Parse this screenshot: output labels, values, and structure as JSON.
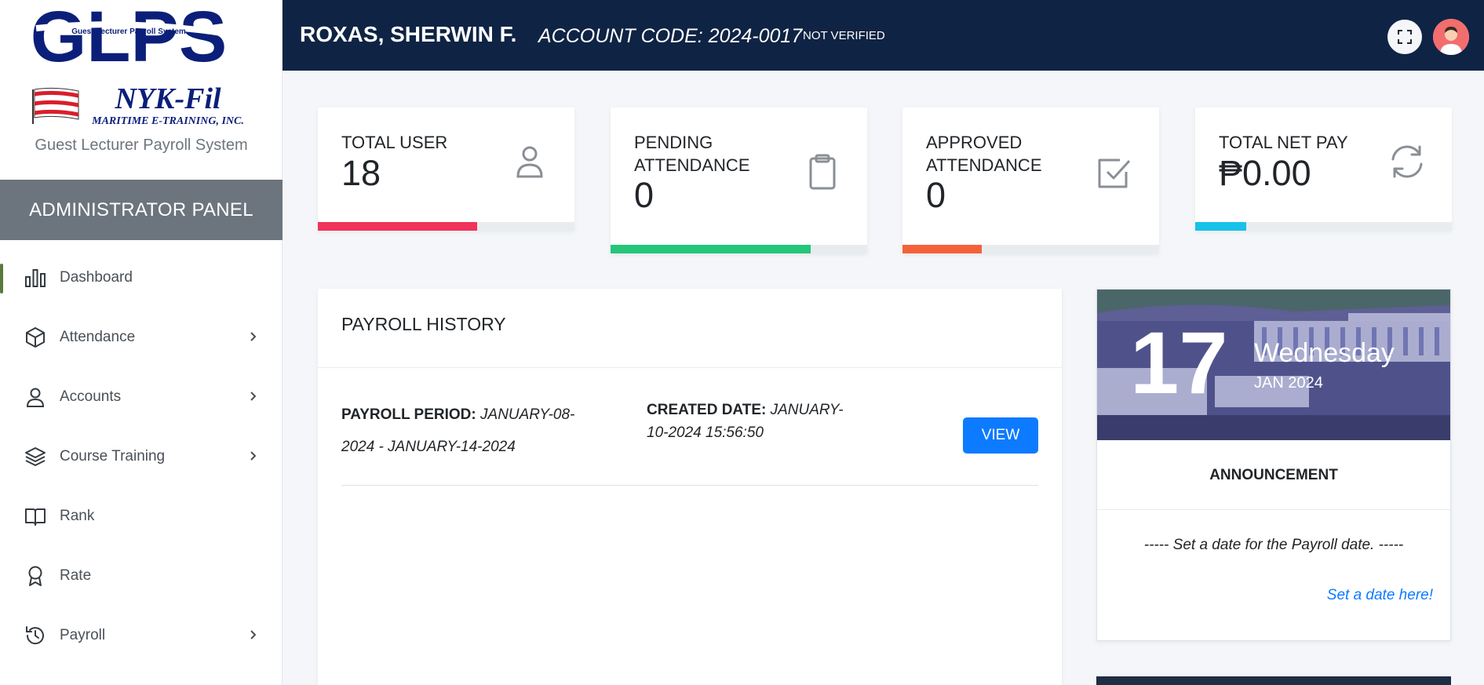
{
  "sidebar": {
    "logo_text": "GLPS",
    "logo_tagline": "Guest Lecturer Payroll System",
    "company_logo_text": "NYK-Fil",
    "company_sub": "MARITIME E-TRAINING, INC.",
    "brand_subtitle": "Guest Lecturer Payroll System",
    "panel_title": "ADMINISTRATOR PANEL",
    "items": [
      {
        "label": "Dashboard",
        "icon": "bar-chart-icon",
        "active": true
      },
      {
        "label": "Attendance",
        "icon": "box-icon",
        "has_submenu": true
      },
      {
        "label": "Accounts",
        "icon": "user-icon",
        "has_submenu": true
      },
      {
        "label": "Course Training",
        "icon": "layers-icon",
        "has_submenu": true
      },
      {
        "label": "Rank",
        "icon": "book-icon"
      },
      {
        "label": "Rate",
        "icon": "award-icon"
      },
      {
        "label": "Payroll",
        "icon": "history-icon",
        "has_submenu": true
      }
    ]
  },
  "topbar": {
    "user_name": "ROXAS, SHERWIN F.",
    "account_code": "ACCOUNT CODE: 2024-0017",
    "status": "NOT VERIFIED"
  },
  "stats": [
    {
      "label": "TOTAL USER",
      "value": "18",
      "icon": "user-icon",
      "color": "#f0335a",
      "fill": 0.62
    },
    {
      "label": "PENDING ATTENDANCE",
      "value": "0",
      "icon": "clipboard-icon",
      "color": "#24c67a",
      "fill": 0.78
    },
    {
      "label": "APPROVED ATTENDANCE",
      "value": "0",
      "icon": "check-square-icon",
      "color": "#f4623a",
      "fill": 0.31
    },
    {
      "label": "TOTAL NET PAY",
      "value": "₱0.00",
      "icon": "refresh-icon",
      "color": "#17c1e8",
      "fill": 0.2
    }
  ],
  "payroll_history": {
    "title": "PAYROLL HISTORY",
    "rows": [
      {
        "period_label": "PAYROLL PERIOD:",
        "period_value": "JANUARY-08-2024 - JANUARY-14-2024",
        "created_label": "CREATED DATE:",
        "created_value": "JANUARY-10-2024 15:56:50",
        "action": "VIEW"
      }
    ]
  },
  "announcement": {
    "day": "17",
    "weekday": "Wednesday",
    "month_year": "JAN 2024",
    "title": "ANNOUNCEMENT",
    "message": "----- Set a date for the Payroll date. -----",
    "link": "Set a date here!"
  },
  "colors": {
    "topbar": "#0f2344",
    "panel": "#6c757d",
    "primary": "#0d7bff"
  }
}
